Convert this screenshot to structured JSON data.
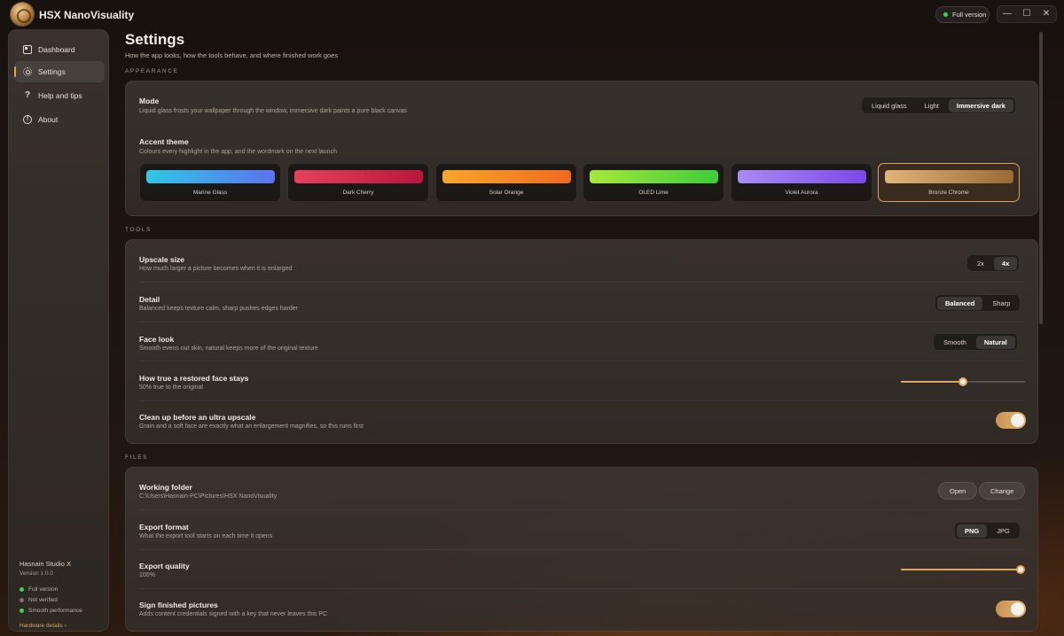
{
  "app": {
    "name": "HSX NanoVisuality",
    "version_badge": "Full version"
  },
  "window_controls": {
    "minimize": "—",
    "maximize": "☐",
    "close": "✕"
  },
  "sidebar": {
    "items": [
      {
        "label": "Dashboard",
        "icon": "dashboard-icon",
        "active": false
      },
      {
        "label": "Settings",
        "icon": "gear-icon",
        "active": true
      },
      {
        "label": "Help and tips",
        "icon": "help-icon",
        "active": false
      },
      {
        "label": "About",
        "icon": "info-icon",
        "active": false
      }
    ],
    "footer": {
      "studio": "Hasnain Studio X",
      "version": "Version 1.0.0",
      "statuses": [
        {
          "label": "Full version",
          "color": "#3ccf5e"
        },
        {
          "label": "Not verified",
          "color": "#7d7570"
        },
        {
          "label": "Smooth performance",
          "color": "#3ccf5e"
        }
      ],
      "hardware_link": "Hardware details ›"
    }
  },
  "page": {
    "title": "Settings",
    "subtitle": "How the app looks, how the tools behave, and where finished work goes"
  },
  "appearance": {
    "section_label": "APPEARANCE",
    "mode": {
      "title": "Mode",
      "desc": "Liquid glass frosts your wallpaper through the window, immersive dark paints a pure black canvas",
      "options": [
        "Liquid glass",
        "Light",
        "Immersive dark"
      ],
      "selected": "Immersive dark"
    },
    "accent": {
      "title": "Accent theme",
      "desc": "Colours every highlight in the app, and the wordmark on the next launch",
      "themes": [
        {
          "name": "Marine Glass",
          "from": "#2fc7e6",
          "to": "#5b72ee"
        },
        {
          "name": "Dark Cherry",
          "from": "#e6415c",
          "to": "#b8163c"
        },
        {
          "name": "Solar Orange",
          "from": "#f9a62a",
          "to": "#ef6a1e"
        },
        {
          "name": "OLED Lime",
          "from": "#a5e83a",
          "to": "#3fcc3b"
        },
        {
          "name": "Violet Aurora",
          "from": "#a98bf5",
          "to": "#7b48e6"
        },
        {
          "name": "Bronze Chrome",
          "from": "#e2b477",
          "to": "#9a6a35"
        }
      ],
      "selected": "Bronze Chrome"
    }
  },
  "tools": {
    "section_label": "TOOLS",
    "upscale": {
      "title": "Upscale size",
      "desc": "How much larger a picture becomes when it is enlarged",
      "options": [
        "2x",
        "4x"
      ],
      "selected": "4x"
    },
    "detail": {
      "title": "Detail",
      "desc": "Balanced keeps texture calm, sharp pushes edges harder",
      "options": [
        "Balanced",
        "Sharp"
      ],
      "selected": "Balanced"
    },
    "face_look": {
      "title": "Face look",
      "desc": "Smooth evens out skin, natural keeps more of the original texture",
      "options": [
        "Smooth",
        "Natural"
      ],
      "selected": "Natural"
    },
    "face_fidelity": {
      "title": "How true a restored face stays",
      "desc": "50% true to the original",
      "value": 0.5
    },
    "cleanup": {
      "title": "Clean up before an ultra upscale",
      "desc": "Grain and a soft face are exactly what an enlargement magnifies, so this runs first",
      "enabled": true
    }
  },
  "files": {
    "section_label": "FILES",
    "working_folder": {
      "title": "Working folder",
      "path": "C:\\Users\\Hasnain-PC\\Pictures\\HSX NanoVisuality",
      "open_label": "Open",
      "change_label": "Change"
    },
    "export_format": {
      "title": "Export format",
      "desc": "What the export tool starts on each time it opens",
      "options": [
        "PNG",
        "JPG"
      ],
      "selected": "PNG"
    },
    "export_quality": {
      "title": "Export quality",
      "desc": "100%",
      "value": 1.0
    },
    "sign": {
      "title": "Sign finished pictures",
      "desc": "Adds content credentials signed with a key that never leaves this PC",
      "enabled": true
    }
  }
}
